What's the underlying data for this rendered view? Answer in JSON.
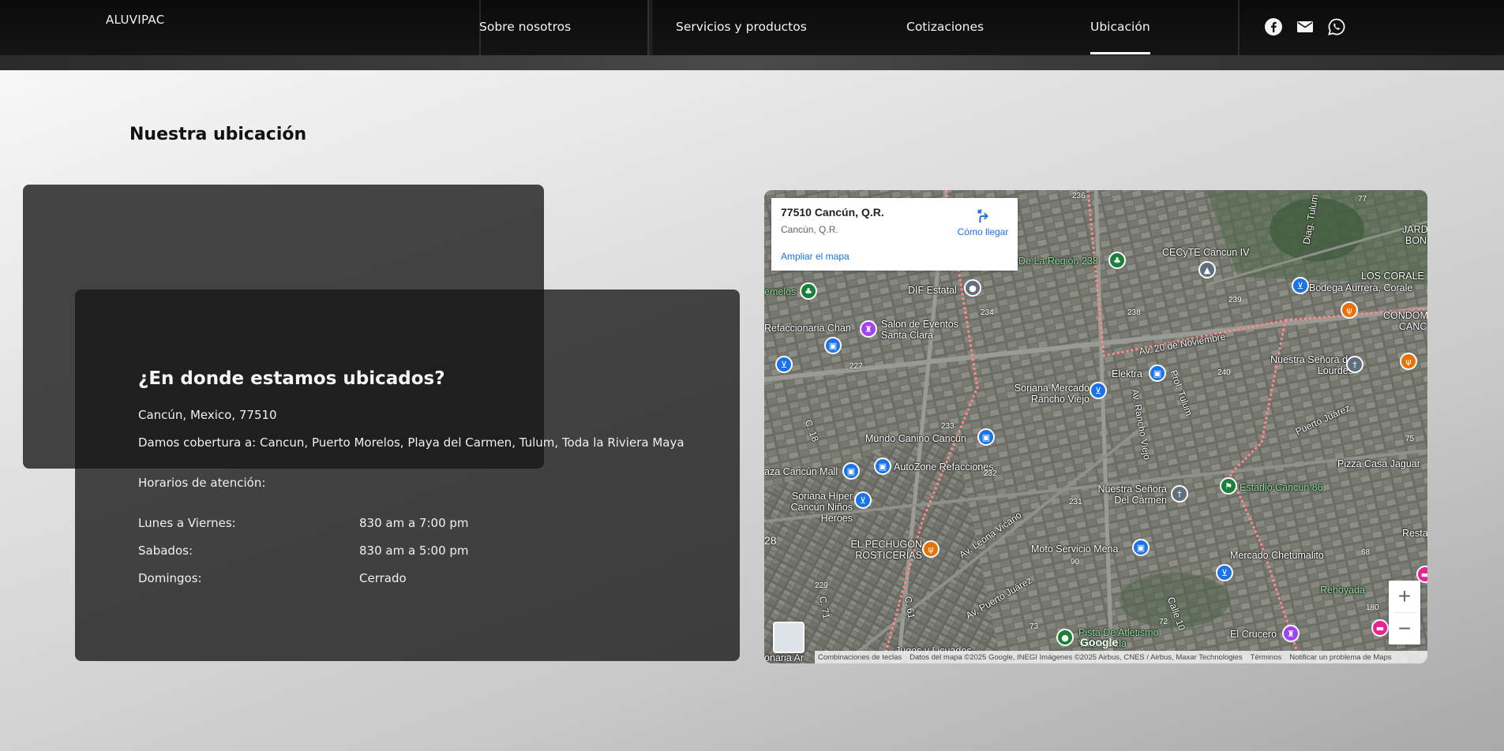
{
  "header": {
    "logo": "ALUVIPAC",
    "nav": [
      {
        "label": "Sobre nosotros"
      },
      {
        "label": "Servicios y productos"
      },
      {
        "label": "Cotizaciones"
      },
      {
        "label": "Ubicación",
        "active": true
      }
    ],
    "social_icons": [
      "facebook-icon",
      "mail-icon",
      "whatsapp-icon"
    ]
  },
  "section": {
    "title": "Nuestra ubicación"
  },
  "info": {
    "title": "¿En donde estamos ubicados?",
    "address": "Cancún, Mexico, 77510",
    "coverage": "Damos cobertura a: Cancun, Puerto Morelos, Playa del Carmen, Tulum, Toda la Riviera Maya",
    "hours_label": "Horarios de atención:",
    "schedule": [
      {
        "day": "Lunes a Viernes:",
        "hours": "830 am a 7:00 pm"
      },
      {
        "day": "Sabados:",
        "hours": "830 am a 5:00 pm"
      },
      {
        "day": "Domingos:",
        "hours": "Cerrado"
      }
    ]
  },
  "map": {
    "place_title": "77510 Cancún, Q.R.",
    "place_subtitle": "Cancún, Q.R.",
    "directions_label": "Cómo llegar",
    "enlarge_label": "Ampliar el mapa",
    "zoom_in": "+",
    "zoom_out": "−",
    "google": "Google",
    "attribution": [
      "Combinaciones de teclas",
      "Datos del mapa ©2025 Google, INEGI Imágenes ©2025 Airbus, CNES / Airbus, Maxar Technologies",
      "Términos",
      "Notificar un problema de Maps"
    ],
    "labels": {
      "de_la_region": "De La Región 238",
      "cecyte": "CECyTE Cancun IV",
      "bodega": "Bodega Aurrera, Corale",
      "jard": "JARD",
      "bon": "BON",
      "los_corale": "LOS CORALE",
      "condo": "CONDOM",
      "canc": "CANC",
      "dif": "DIF Estatal",
      "gemelos": "emelos",
      "refaccionaria": "Refaccionaria Chan",
      "salon": "Salon de Eventos Santa Clara",
      "av20": "Av. 20 de Noviembre",
      "nuestra_lourdes": "Nuestra Señora de Lourdes",
      "elektra": "Elektra",
      "soriana_rancho": "Soriana Mercado Rancho Viejo",
      "av_rancho_viejo": "Av. Rancho Viejo",
      "prol_tulum": "Prol. Tulum",
      "puerto_juarez_label": "Puerto Juárez",
      "pizza_casa": "Pizza Casa Jaguar",
      "mundo_canino": "Mundo Canino Cancun",
      "plaza_cancun_mall": "aza Cancún Mall",
      "autozone": "AutoZone Refacciones",
      "nuestra_carmen": "Nuestra Señora Del Carmen",
      "estadio": "Estadio Cancún 86",
      "soriana_hiper": "Soriana Híper Cancún Niños Heroes",
      "pechugon": "EL PECHUGÓN ROSTICERÍAS",
      "av_leona": "Av. Leona Vicario",
      "moto_servicio": "Moto Servicio Mena",
      "mercado_chetu": "Mercado Chetumalito",
      "av_puerto_juarez": "Av. Puerto Juárez",
      "restau": "Restau",
      "rehoyada": "Rehoyada",
      "pista": "Pista De Atletismo",
      "valenzuela": "Valenzuela",
      "crucero": "El Crucero",
      "diag_tulum": "Diag. Tulum",
      "c18": "C. 18",
      "c61": "C. 61",
      "c71": "C. 71",
      "calle10": "Calle 10",
      "jugos": "Jugos y Licuados",
      "onaria": "onaria Ar",
      "n236": "236",
      "n77": "77",
      "n234": "234",
      "n238": "238",
      "n239": "239",
      "n227": "227",
      "n240": "240",
      "n233": "233",
      "n232": "232",
      "n231": "231",
      "n75": "75",
      "n28": "28",
      "n229": "229",
      "n90": "90",
      "n68": "68",
      "n73": "73",
      "n72": "72",
      "n180": "180",
      "n61": "61"
    }
  }
}
